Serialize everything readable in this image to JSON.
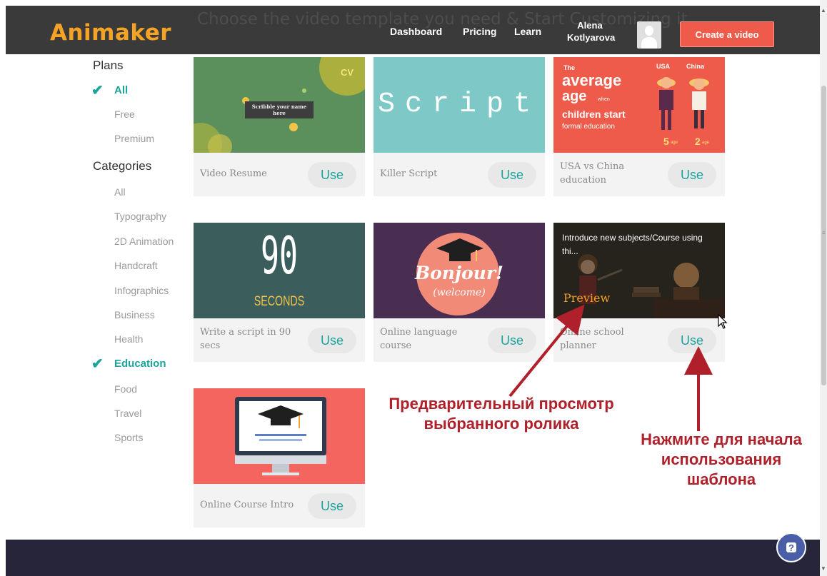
{
  "header": {
    "ghost_title": "Choose the video template you need & Start Customizing it",
    "logo": "Animaker",
    "nav": [
      "Dashboard",
      "Pricing",
      "Learn"
    ],
    "user_first": "Alena",
    "user_last": "Kotlyarova",
    "create_button": "Create a video"
  },
  "sidebar": {
    "plans_heading": "Plans",
    "plans": [
      {
        "label": "All",
        "active": true
      },
      {
        "label": "Free",
        "active": false
      },
      {
        "label": "Premium",
        "active": false
      }
    ],
    "categories_heading": "Categories",
    "categories": [
      {
        "label": "All",
        "active": false
      },
      {
        "label": "Typography",
        "active": false
      },
      {
        "label": "2D Animation",
        "active": false
      },
      {
        "label": "Handcraft",
        "active": false
      },
      {
        "label": "Infographics",
        "active": false
      },
      {
        "label": "Business",
        "active": false
      },
      {
        "label": "Health",
        "active": false
      },
      {
        "label": "Education",
        "active": true
      },
      {
        "label": "Food",
        "active": false
      },
      {
        "label": "Travel",
        "active": false
      },
      {
        "label": "Sports",
        "active": false
      }
    ]
  },
  "cards": [
    {
      "title": "Video Resume",
      "use": "Use",
      "thumb": {
        "corner": "CV",
        "caption": "Scribble your name here",
        "bg": "#5b8f5b"
      }
    },
    {
      "title": "Killer Script",
      "use": "Use",
      "thumb": {
        "text": "Script",
        "bg": "#7ec9c7"
      }
    },
    {
      "title": "USA vs China education",
      "use": "Use",
      "thumb": {
        "line1": "The",
        "line2": "average",
        "line3": "age",
        "line3b": "when",
        "line4": "children start",
        "line5": "formal education",
        "usa": "USA",
        "china": "China",
        "n1": "5",
        "n1u": "age",
        "n2": "2",
        "n2u": "age",
        "bg": "#ef5b4a"
      }
    },
    {
      "title": "Write a script in 90 secs",
      "use": "Use",
      "thumb": {
        "big": "90",
        "small": "SECONDS",
        "bg": "#3b5e5d"
      }
    },
    {
      "title": "Online language course",
      "use": "Use",
      "thumb": {
        "line1": "Bonjour!",
        "line2": "(welcome)",
        "bg": "#4a2e52"
      }
    },
    {
      "title": "Online school planner",
      "use": "Use",
      "thumb": {
        "text": "Introduce new subjects/Course using thi...",
        "preview": "Preview",
        "bg": "#2a2a24"
      }
    },
    {
      "title": "Online Course Intro",
      "use": "Use",
      "thumb": {
        "bg": "#f5655f"
      }
    }
  ],
  "annotations": {
    "preview_note": [
      "Предварительный просмотр",
      "выбранного ролика"
    ],
    "use_note": [
      "Нажмите для начала",
      "использования",
      "шаблона"
    ]
  },
  "chat": {
    "icon": "?"
  },
  "colors": {
    "accent": "#1ba39c",
    "header_bg": "#3a3a3a",
    "logo": "#f4a325",
    "create": "#ef5b4a",
    "annotation": "#b0202a"
  }
}
